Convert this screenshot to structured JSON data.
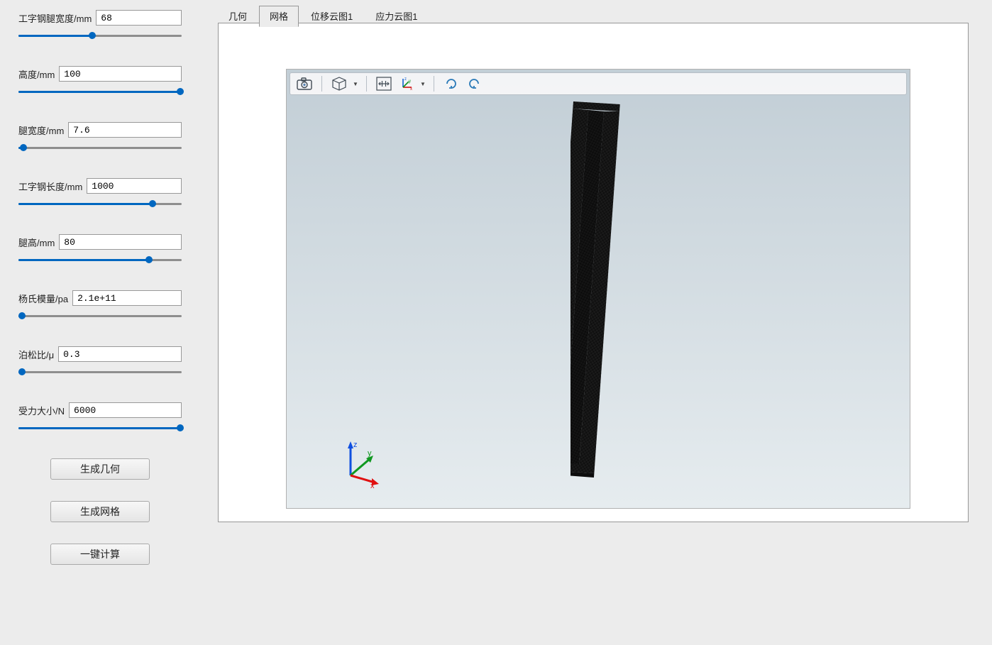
{
  "params": [
    {
      "label": "工字钢腿宽度/mm",
      "value": "68",
      "pct": 45
    },
    {
      "label": "高度/mm",
      "value": "100",
      "pct": 99
    },
    {
      "label": "腿宽度/mm",
      "value": "7.6",
      "pct": 3
    },
    {
      "label": "工字钢长度/mm",
      "value": "1000",
      "pct": 82
    },
    {
      "label": "腿高/mm",
      "value": "80",
      "pct": 80
    },
    {
      "label": "杨氏模量/pa",
      "value": "2.1e+11",
      "pct": 2
    },
    {
      "label": "泊松比/μ",
      "value": "0.3",
      "pct": 2
    },
    {
      "label": "受力大小/N",
      "value": "6000",
      "pct": 99
    }
  ],
  "buttons": {
    "gen_geom": "生成几何",
    "gen_mesh": "生成网格",
    "one_click": "一键计算"
  },
  "tabs": [
    {
      "label": "几何",
      "active": false
    },
    {
      "label": "网格",
      "active": true
    },
    {
      "label": "位移云图1",
      "active": false
    },
    {
      "label": "应力云图1",
      "active": false
    }
  ],
  "toolbar_icons": {
    "camera": "camera-icon",
    "cube": "cube-icon",
    "fit": "fit-view-icon",
    "axes": "axes-icon",
    "rotcw": "rotate-cw-icon",
    "rotccw": "rotate-ccw-icon"
  },
  "triad": {
    "x": "x",
    "y": "y",
    "z": "z"
  }
}
